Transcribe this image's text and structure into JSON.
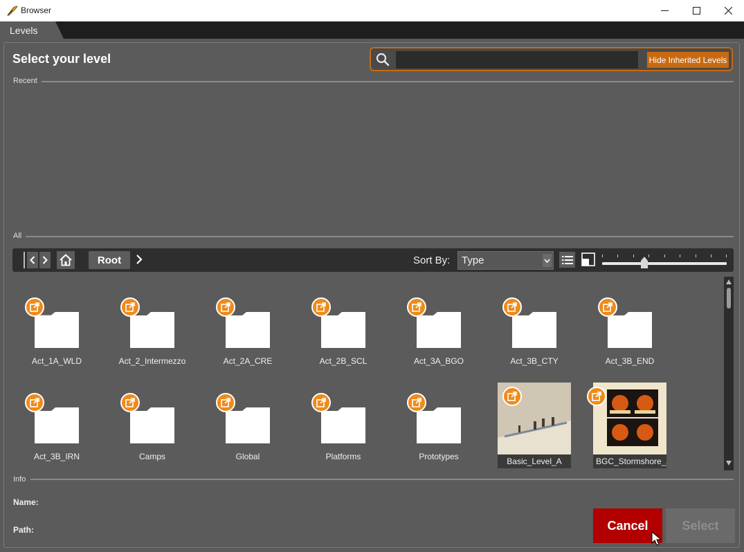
{
  "window": {
    "title": "Browser",
    "icon": "feather-icon"
  },
  "tabs": [
    {
      "label": "Levels"
    }
  ],
  "header": {
    "title": "Select your level"
  },
  "search": {
    "value": "",
    "placeholder": "",
    "hide_inherited_label": "Hide Inherited Levels"
  },
  "sections": {
    "recent": "Recent",
    "all": "All",
    "info": "Info"
  },
  "toolbar": {
    "breadcrumb": "Root",
    "sort_label": "Sort By:",
    "sort_value": "Type",
    "icons": [
      "back-icon",
      "forward-icon",
      "home-icon",
      "list-view-icon",
      "thumbnail-size-icon"
    ]
  },
  "items": [
    {
      "name": "Act_1A_WLD",
      "kind": "folder"
    },
    {
      "name": "Act_2_Intermezzo",
      "kind": "folder"
    },
    {
      "name": "Act_2A_CRE",
      "kind": "folder"
    },
    {
      "name": "Act_2B_SCL",
      "kind": "folder"
    },
    {
      "name": "Act_3A_BGO",
      "kind": "folder"
    },
    {
      "name": "Act_3B_CTY",
      "kind": "folder"
    },
    {
      "name": "Act_3B_END",
      "kind": "folder"
    },
    {
      "name": "Act_3B_IRN",
      "kind": "folder"
    },
    {
      "name": "Camps",
      "kind": "folder"
    },
    {
      "name": "Global",
      "kind": "folder"
    },
    {
      "name": "Platforms",
      "kind": "folder"
    },
    {
      "name": "Prototypes",
      "kind": "folder"
    },
    {
      "name": "Basic_Level_A",
      "kind": "level"
    },
    {
      "name": "BGC_Stormshore_A",
      "kind": "level"
    }
  ],
  "info": {
    "name_label": "Name:",
    "path_label": "Path:"
  },
  "buttons": {
    "cancel": "Cancel",
    "select": "Select"
  },
  "colors": {
    "accent": "#c86a12",
    "badge": "#ef8b1a",
    "cancel": "#b20000"
  }
}
